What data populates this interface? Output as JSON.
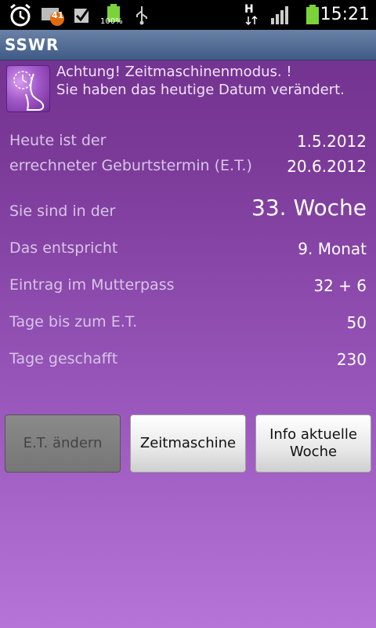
{
  "status_bar": {
    "icons": [
      "alarm-clock-icon",
      "mail-icon",
      "check-icon",
      "battery-icon",
      "usb-icon"
    ],
    "notification_count": "41",
    "battery_percent_label": "100%",
    "network_type": "H",
    "signal_icon": "signal-bars-icon",
    "battery_icon": "battery-icon",
    "time": "15:21"
  },
  "app": {
    "title": "SSWR"
  },
  "warning": {
    "icon": "pregnancy-clock-icon",
    "line1": "Achtung! Zeitmaschinenmodus. !",
    "line2": "Sie haben das heutige Datum verändert."
  },
  "rows": [
    {
      "label": "Heute ist der",
      "value": "1.5.2012"
    },
    {
      "label": "errechneter Geburtstermin (E.T.)",
      "value": "20.6.2012"
    },
    {
      "label": "Sie sind in der",
      "value": "33. Woche"
    },
    {
      "label": "Das entspricht",
      "value": "9. Monat"
    },
    {
      "label": "Eintrag im Mutterpass",
      "value": "32 + 6"
    },
    {
      "label": "Tage bis zum E.T.",
      "value": "50"
    },
    {
      "label": "Tage geschafft",
      "value": "230"
    }
  ],
  "buttons": {
    "change_et": "E.T. ändern",
    "time_machine": "Zeitmaschine",
    "info_line1": "Info aktuelle",
    "info_line2": "Woche"
  },
  "colors": {
    "background_top": "#6f2f8d",
    "background_bottom": "#b673d8",
    "title_bar": "#4e6a93"
  }
}
